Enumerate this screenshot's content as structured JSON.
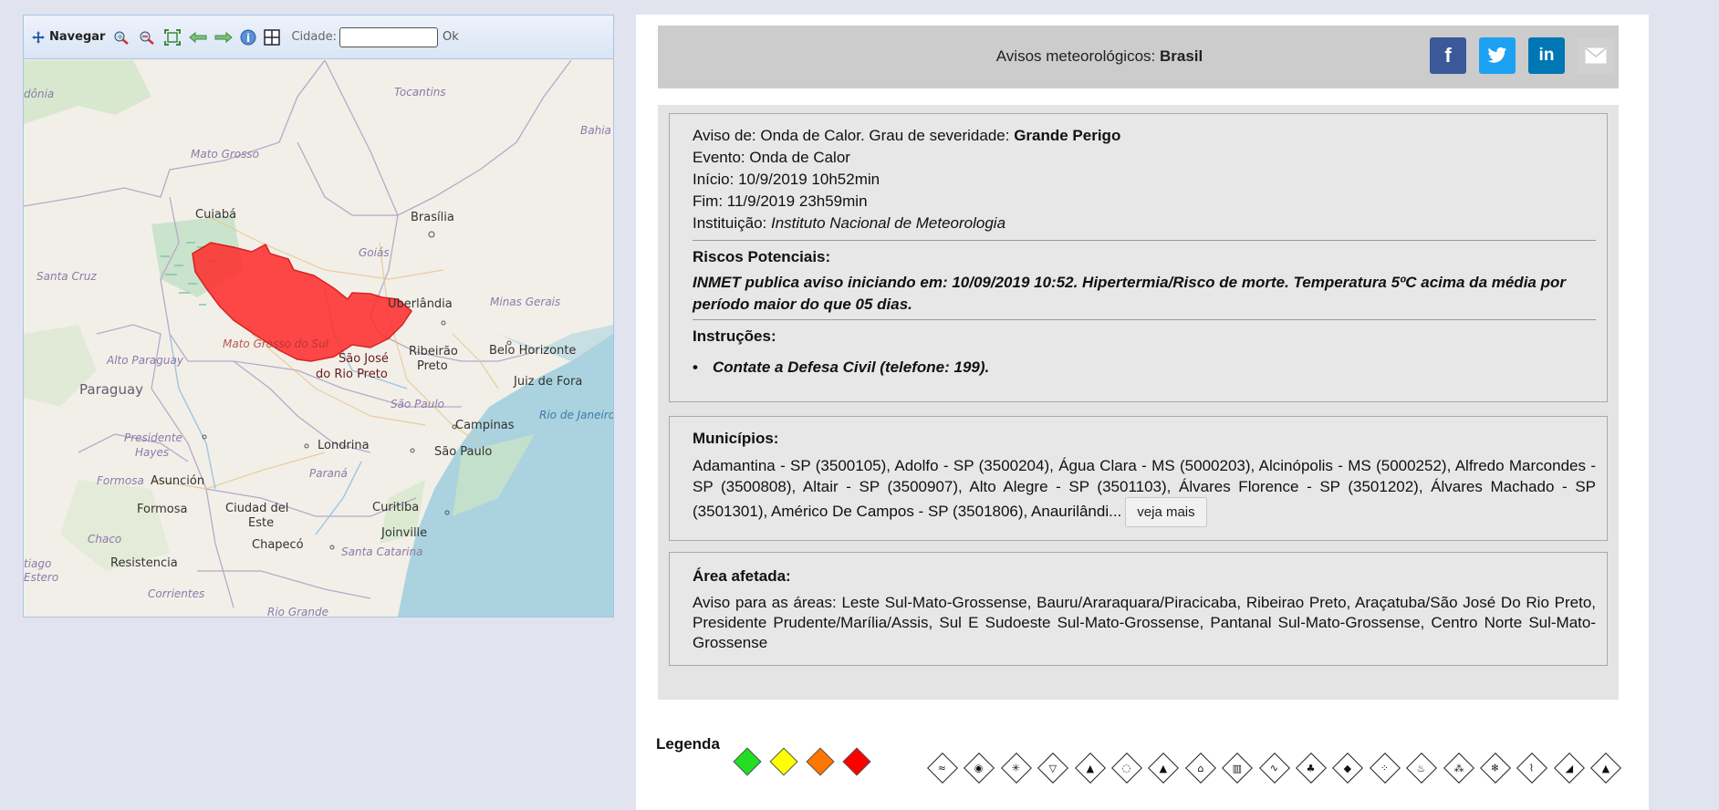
{
  "map_toolbar": {
    "navegar_label": "Navegar",
    "cidade_label": "Cidade:",
    "cidade_value": "",
    "ok_label": "Ok"
  },
  "map": {
    "labels": {
      "rondonia": "dônia",
      "tocantins": "Tocantins",
      "bahia": "Bahia",
      "mato_grosso": "Mato Grosso",
      "cuiaba": "Cuiabá",
      "brasilia": "Brasília",
      "goias": "Goiás",
      "santa_cruz": "Santa Cruz",
      "minas_gerais": "Minas Gerais",
      "uberlandia": "Uberlândia",
      "mato_grosso_do_sul": "Mato Grosso do Sul",
      "alto_paraguay": "Alto Paraguay",
      "paraguay": "Paraguay",
      "sao_jose_1": "São José",
      "sao_jose_2": "do Rio Preto",
      "ribeirao_1": "Ribeirão",
      "ribeirao_2": "Preto",
      "belo_horizonte": "Belo Horizonte",
      "juiz_de_fora": "Juiz de Fora",
      "sao_paulo_state": "São Paulo",
      "rio_de_janeiro": "Rio de Janeiro",
      "campinas": "Campinas",
      "presidente_hayes_1": "Presidente",
      "presidente_hayes_2": "Hayes",
      "londrina": "Londrina",
      "sao_paulo": "São Paulo",
      "formosa_it": "Formosa",
      "asuncion": "Asunción",
      "parana": "Paraná",
      "formosa": "Formosa",
      "ciudad_del_este_1": "Ciudad del",
      "ciudad_del_este_2": "Este",
      "curitiba": "Curitiba",
      "chaco": "Chaco",
      "joinville": "Joinville",
      "chapeco": "Chapecó",
      "santa_catarina": "Santa Catarina",
      "santiago_1": "tiago",
      "santiago_2": "Estero",
      "resistencia": "Resistencia",
      "corrientes": "Corrientes",
      "rio_grande": "Rio Grande"
    },
    "alert_color": "#ff2a2a"
  },
  "header": {
    "title_prefix": "Avisos meteorológicos: ",
    "title_region": "Brasil",
    "share": [
      {
        "icon": "facebook-icon",
        "glyph": "f",
        "color": "#3b5998"
      },
      {
        "icon": "twitter-icon",
        "glyph": "",
        "color": "#1da1f2"
      },
      {
        "icon": "linkedin-icon",
        "glyph": "in",
        "color": "#0077b5"
      },
      {
        "icon": "email-icon",
        "glyph": "",
        "color": "#d0d0d0"
      }
    ]
  },
  "alert": {
    "aviso_prefix": "Aviso de: Onda de Calor. Grau de severidade: ",
    "severidade": "Grande Perigo",
    "evento": "Evento: Onda de Calor",
    "inicio": "Início: 10/9/2019 10h52min",
    "fim": "Fim: 11/9/2019 23h59min",
    "instituicao_prefix": "Instituição: ",
    "instituicao": "Instituto Nacional de Meteorologia",
    "riscos_title": "Riscos Potenciais:",
    "riscos_text": "INMET publica aviso iniciando em: 10/09/2019 10:52. Hipertermia/Risco de morte. Temperatura 5ºC acima da média por período maior do que 05 dias.",
    "instrucoes_title": "Instruções:",
    "instrucao_item": "Contate a Defesa Civil (telefone: 199)."
  },
  "municipios": {
    "title": "Municípios:",
    "text": "Adamantina - SP (3500105), Adolfo - SP (3500204), Água Clara - MS (5000203), Alcinópolis - MS (5000252), Alfredo Marcondes - SP (3500808), Altair - SP (3500907), Alto Alegre - SP (3501103), Álvares Florence - SP (3501202), Álvares Machado - SP (3501301), Américo De Campos - SP (3501806), Anaurilândi...",
    "veja_mais": "veja mais"
  },
  "area": {
    "title": "Área afetada:",
    "text": "Aviso para as áreas: Leste Sul-Mato-Grossense, Bauru/Araraquara/Piracicaba, Ribeirao Preto, Araçatuba/São José Do Rio Preto, Presidente Prudente/Marília/Assis, Sul E Sudoeste Sul-Mato-Grossense, Pantanal Sul-Mato-Grossense, Centro Norte Sul-Mato-Grossense"
  },
  "legend": {
    "title": "Legenda",
    "severity_colors": [
      "#22dd22",
      "#ffff00",
      "#ff7700",
      "#ff0000"
    ],
    "event_icons": [
      "frost-icon",
      "storm-surge-icon",
      "snow-icon",
      "dry-air-icon",
      "heavy-rain-icon",
      "fog-icon",
      "rain-icon",
      "landslide-icon",
      "low-humidity-icon",
      "coastal-wind-icon",
      "wind-icon",
      "thunderstorm-icon",
      "hail-icon",
      "fire-icon",
      "pollen-icon",
      "cold-wave-icon",
      "heat-wave-icon",
      "tsunami-icon",
      "volcano-icon"
    ],
    "event_glyphs": [
      "≈",
      "◉",
      "✳",
      "▽",
      "▲",
      "◌",
      "▲",
      "⌂",
      "▥",
      "∿",
      "♣",
      "◆",
      "⁘",
      "♨",
      "⁂",
      "❄",
      "⌇",
      "◢",
      "▲"
    ]
  }
}
